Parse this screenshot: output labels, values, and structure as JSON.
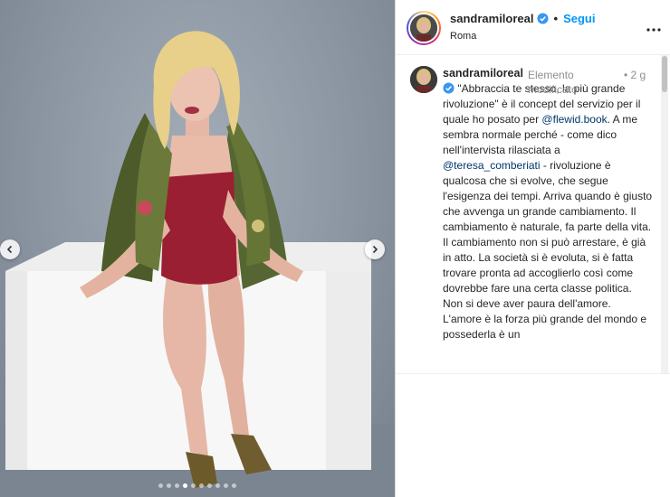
{
  "post": {
    "username": "sandramiloreal",
    "follow_label": "Segui",
    "separator": "•",
    "location": "Roma",
    "more_icon": "more-horizontal-icon",
    "verified_color": "#3897f0",
    "follow_color": "#0095f6"
  },
  "carousel": {
    "total_slides": 10,
    "active_index": 3
  },
  "comment": {
    "username": "sandramiloreal",
    "edited_label": "Elemento modificato",
    "dot": "•",
    "time": "2 g",
    "text_part1": " \"Abbraccia te stesso, la più grande rivoluzione\" è il concept del servizio per il quale ho posato per ",
    "mention1": "@flewid.book",
    "text_part2": ". A me sembra normale perché - come dico nell'intervista rilasciata a ",
    "mention2": "@teresa_comberiati",
    "text_part3": " - rivoluzione è qualcosa che si evolve, che segue l'esigenza dei tempi. Arriva quando è giusto che avvenga un grande cambiamento. Il cambiamento è naturale, fa parte della vita. Il cambiamento non si può arrestare, è già in atto. La società si è evoluta, si è fatta trovare pronta ad accoglierlo così come dovrebbe fare una certa classe politica. Non si deve aver paura dell'amore. L'amore è la forza più grande del mondo e possederla è un"
  }
}
